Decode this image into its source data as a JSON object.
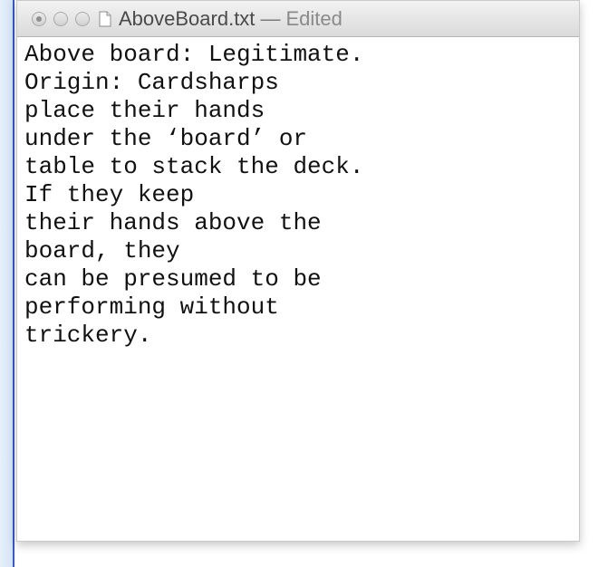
{
  "window": {
    "filename": "AboveBoard.txt",
    "separator": "—",
    "status": "Edited"
  },
  "document": {
    "text": "Above board: Legitimate.\nOrigin: Cardsharps\nplace their hands\nunder the ‘board’ or\ntable to stack the deck.\nIf they keep\ntheir hands above the\nboard, they\ncan be presumed to be\nperforming without\ntrickery."
  },
  "icons": {
    "close": "close-button-icon",
    "minimize": "minimize-button-icon",
    "zoom": "zoom-button-icon",
    "document": "text-document-icon"
  },
  "colors": {
    "accent": "#3b58c9",
    "titlebar_top": "#f2f2f2",
    "titlebar_bottom": "#dadada",
    "text": "#111111"
  }
}
